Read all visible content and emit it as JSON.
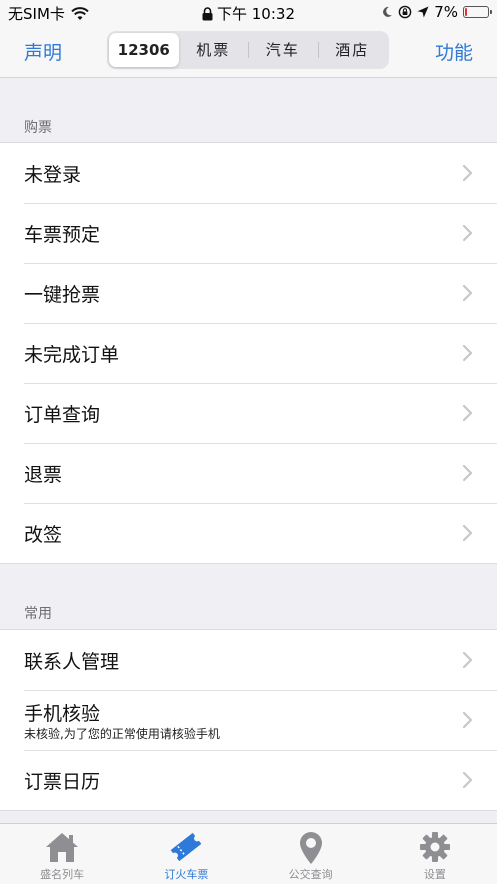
{
  "status_bar": {
    "carrier": "无SIM卡",
    "time": "下午 10:32",
    "battery": "7%",
    "battery_level": 0.07,
    "icons": [
      "wifi-icon",
      "lock-icon",
      "moon-icon",
      "orientation-lock-icon",
      "location-arrow-icon",
      "battery-icon"
    ]
  },
  "nav": {
    "left": "声明",
    "right": "功能",
    "segments": [
      {
        "label": "12306",
        "active": true
      },
      {
        "label": "机票",
        "active": false
      },
      {
        "label": "汽车",
        "active": false
      },
      {
        "label": "酒店",
        "active": false
      }
    ]
  },
  "sections": [
    {
      "header": "购票",
      "rows": [
        {
          "title": "未登录"
        },
        {
          "title": "车票预定"
        },
        {
          "title": "一键抢票"
        },
        {
          "title": "未完成订单"
        },
        {
          "title": "订单查询"
        },
        {
          "title": "退票"
        },
        {
          "title": "改签"
        }
      ]
    },
    {
      "header": "常用",
      "rows": [
        {
          "title": "联系人管理"
        },
        {
          "title": "手机核验",
          "subtitle": "未核验,为了您的正常使用请核验手机"
        },
        {
          "title": "订票日历"
        }
      ]
    }
  ],
  "tabs": [
    {
      "label": "盛名列车",
      "icon": "home-icon",
      "active": false
    },
    {
      "label": "订火车票",
      "icon": "ticket-icon",
      "active": true
    },
    {
      "label": "公交查询",
      "icon": "map-pin-icon",
      "active": false
    },
    {
      "label": "设置",
      "icon": "gear-icon",
      "active": false
    }
  ],
  "colors": {
    "accent": "#2f7ad8",
    "background": "#efeff4",
    "tab_inactive": "#8e8e93",
    "battery_low": "#e33333"
  }
}
